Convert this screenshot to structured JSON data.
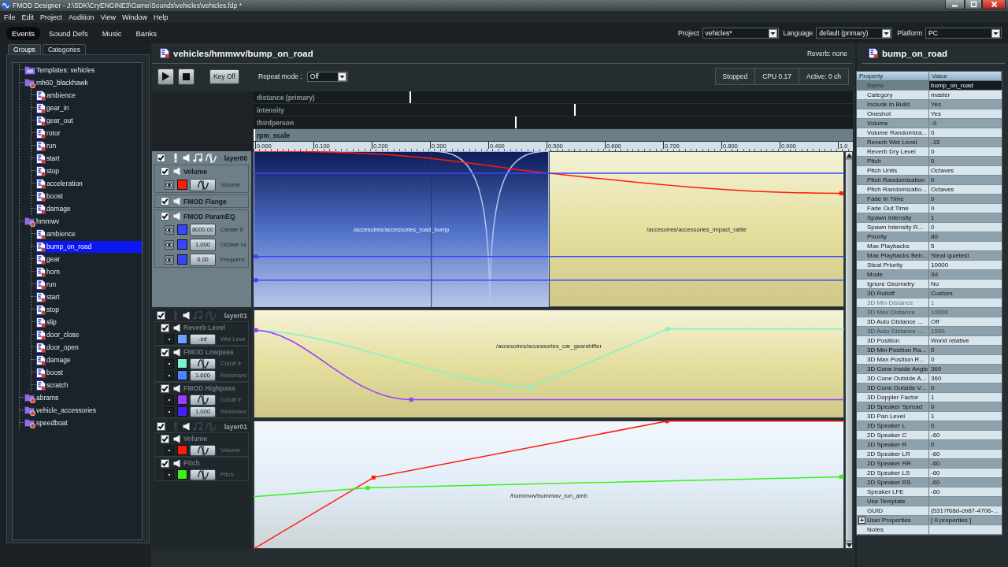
{
  "window": {
    "title": "FMOD Designer - J:\\SDK\\CryENGINE3\\Game\\Sounds\\vehicles\\vehicles.fdp *"
  },
  "menu": [
    "File",
    "Edit",
    "Project",
    "Audition",
    "View",
    "Window",
    "Help"
  ],
  "modes": [
    {
      "label": "Events",
      "selected": true
    },
    {
      "label": "Sound Defs",
      "selected": false
    },
    {
      "label": "Music",
      "selected": false
    },
    {
      "label": "Banks",
      "selected": false
    }
  ],
  "selectors": [
    {
      "label": "Project",
      "value": "vehicles*"
    },
    {
      "label": "Language",
      "value": "default (primary)"
    },
    {
      "label": "Platform",
      "value": "PC"
    }
  ],
  "sidebar": {
    "tabs": [
      {
        "label": "Groups",
        "selected": true
      },
      {
        "label": "Categories",
        "selected": false
      }
    ],
    "tree": [
      {
        "label": "Templates: vehicles",
        "kind": "template",
        "selected": false
      },
      {
        "label": "mh60_blackhawk",
        "kind": "group",
        "selected": false,
        "children": [
          {
            "label": "ambience",
            "kind": "event",
            "selected": false
          },
          {
            "label": "gear_in",
            "kind": "event",
            "selected": false
          },
          {
            "label": "gear_out",
            "kind": "event",
            "selected": false
          },
          {
            "label": "rotor",
            "kind": "event",
            "selected": false
          },
          {
            "label": "run",
            "kind": "event",
            "selected": false
          },
          {
            "label": "start",
            "kind": "event",
            "selected": false
          },
          {
            "label": "stop",
            "kind": "event",
            "selected": false
          },
          {
            "label": "acceleration",
            "kind": "event",
            "selected": false
          },
          {
            "label": "boost",
            "kind": "event",
            "selected": false
          },
          {
            "label": "damage",
            "kind": "event",
            "selected": false
          }
        ]
      },
      {
        "label": "hmmwv",
        "kind": "group",
        "selected": false,
        "children": [
          {
            "label": "ambience",
            "kind": "event",
            "selected": false
          },
          {
            "label": "bump_on_road",
            "kind": "event",
            "selected": true
          },
          {
            "label": "gear",
            "kind": "event",
            "selected": false
          },
          {
            "label": "horn",
            "kind": "event",
            "selected": false
          },
          {
            "label": "run",
            "kind": "event",
            "selected": false
          },
          {
            "label": "start",
            "kind": "event",
            "selected": false
          },
          {
            "label": "stop",
            "kind": "event",
            "selected": false
          },
          {
            "label": "slip",
            "kind": "event",
            "selected": false
          },
          {
            "label": "door_close",
            "kind": "event",
            "selected": false
          },
          {
            "label": "door_open",
            "kind": "event",
            "selected": false
          },
          {
            "label": "damage",
            "kind": "event",
            "selected": false
          },
          {
            "label": "boost",
            "kind": "event",
            "selected": false
          },
          {
            "label": "scratch",
            "kind": "event",
            "selected": false
          }
        ]
      },
      {
        "label": "abrams",
        "kind": "group",
        "selected": false
      },
      {
        "label": "vehicle_accessories",
        "kind": "group",
        "selected": false
      },
      {
        "label": "speedboat",
        "kind": "group",
        "selected": false
      }
    ]
  },
  "event": {
    "title": "vehicles/hmmwv/bump_on_road",
    "reverb": "Reverb: none",
    "key_off": "Key Off",
    "repeat_mode": {
      "label": "Repeat mode :",
      "value": "Off"
    },
    "status": [
      "Stopped",
      "CPU 0.17",
      "Active: 0 ch"
    ],
    "parameters": [
      {
        "name": "distance (primary)",
        "selected": false,
        "level": 0.26
      },
      {
        "name": "intensity",
        "selected": false,
        "level": 0.535
      },
      {
        "name": "thirdperson",
        "selected": false,
        "level": 0.436
      },
      {
        "name": "rpm_scale",
        "selected": true,
        "level": 0
      }
    ],
    "ruler": [
      "0.000",
      "0.100",
      "0.200",
      "0.300",
      "0.400",
      "0.500",
      "0.600",
      "0.700",
      "0.800",
      "0.900",
      "1.0"
    ],
    "layers": [
      {
        "name": "layer00",
        "selected": true,
        "checked": true,
        "effects": [
          {
            "name": "Volume",
            "checked": true,
            "params": [
              {
                "kind": "curve",
                "color": "#ff1a0a",
                "label": "Volume"
              }
            ]
          },
          {
            "name": "FMOD Flange",
            "checked": true
          },
          {
            "name": "FMOD ParamEQ",
            "checked": true,
            "params": [
              {
                "kind": "value",
                "value": "8000.00",
                "color": "#3b45ff",
                "label": "Center fr"
              },
              {
                "kind": "value",
                "value": "1.000",
                "color": "#3b45ff",
                "label": "Octave ra"
              },
              {
                "kind": "value",
                "value": "0.00",
                "color": "#3b45ff",
                "label": "Frequenc"
              }
            ]
          }
        ],
        "instances": [
          {
            "label": "/accesoires/accessories_road_bump",
            "selected": true,
            "color": "#4d6fc6"
          },
          {
            "label": "/accesoires/accessories_impact_rattle",
            "selected": false,
            "color": "#e5df9e"
          }
        ]
      },
      {
        "name": "layer01",
        "selected": false,
        "checked": true,
        "effects": [
          {
            "name": "Reverb Level",
            "checked": true,
            "params": [
              {
                "kind": "value",
                "value": "-inf",
                "color": "#6f9cff",
                "label": "Wet Leve"
              }
            ]
          },
          {
            "name": "FMOD Lowpass",
            "checked": true,
            "params": [
              {
                "kind": "curve",
                "color": "#7cf5c8",
                "label": "Cutoff fr"
              },
              {
                "kind": "value",
                "value": "1.000",
                "color": "#4a86ff",
                "label": "Resonanc"
              }
            ]
          },
          {
            "name": "FMOD Highpass",
            "checked": true,
            "params": [
              {
                "kind": "curve",
                "color": "#9b3cff",
                "label": "Cutoff fr"
              },
              {
                "kind": "value",
                "value": "1.000",
                "color": "#4a1cff",
                "label": "Resonanc"
              }
            ]
          }
        ],
        "instances": [
          {
            "label": "/accesoires/accessories_car_gearshifter",
            "selected": false,
            "color": "#e5df9e"
          }
        ]
      },
      {
        "name": "layer01",
        "selected": false,
        "checked": true,
        "effects": [
          {
            "name": "Volume",
            "checked": true,
            "params": [
              {
                "kind": "curve",
                "color": "#ff1a0a",
                "label": "Volume"
              }
            ]
          },
          {
            "name": "Pitch",
            "checked": true,
            "params": [
              {
                "kind": "curve",
                "color": "#3cf01a",
                "label": "Pitch"
              }
            ]
          }
        ],
        "instances": [
          {
            "label": "/hummvw/hummwv_run_amb",
            "selected": false,
            "color": "#e2edf8"
          }
        ]
      }
    ]
  },
  "properties": {
    "title": "bump_on_road",
    "columns": [
      "Property",
      "Value"
    ],
    "rows": [
      {
        "property": "Name",
        "value": "bump_on_road",
        "selected": true,
        "disabled": false
      },
      {
        "property": "Category",
        "value": "master",
        "selected": false,
        "disabled": false
      },
      {
        "property": "Include in Build",
        "value": "Yes",
        "selected": false,
        "disabled": false
      },
      {
        "property": "Oneshot",
        "value": "Yes",
        "selected": false,
        "disabled": false
      },
      {
        "property": "Volume",
        "value": "-9",
        "selected": false,
        "disabled": false
      },
      {
        "property": "Volume Randomiza...",
        "value": "0",
        "selected": false,
        "disabled": false
      },
      {
        "property": "Reverb Wet Level",
        "value": "-15",
        "selected": false,
        "disabled": false
      },
      {
        "property": "Reverb Dry Level",
        "value": "0",
        "selected": false,
        "disabled": false
      },
      {
        "property": "Pitch",
        "value": "0",
        "selected": false,
        "disabled": false
      },
      {
        "property": "Pitch Units",
        "value": "Octaves",
        "selected": false,
        "disabled": false
      },
      {
        "property": "Pitch Randomization",
        "value": "0",
        "selected": false,
        "disabled": false
      },
      {
        "property": "Pitch Randomizatio...",
        "value": "Octaves",
        "selected": false,
        "disabled": false
      },
      {
        "property": "Fade In Time",
        "value": "0",
        "selected": false,
        "disabled": false
      },
      {
        "property": "Fade Out Time",
        "value": "0",
        "selected": false,
        "disabled": false
      },
      {
        "property": "Spawn Intensity",
        "value": "1",
        "selected": false,
        "disabled": false
      },
      {
        "property": "Spawn Intensity R...",
        "value": "0",
        "selected": false,
        "disabled": false
      },
      {
        "property": "Priority",
        "value": "80",
        "selected": false,
        "disabled": false
      },
      {
        "property": "Max Playbacks",
        "value": "5",
        "selected": false,
        "disabled": false
      },
      {
        "property": "Max Playbacks Beh...",
        "value": "Steal quietest",
        "selected": false,
        "disabled": false
      },
      {
        "property": "Steal Priority",
        "value": "10000",
        "selected": false,
        "disabled": false
      },
      {
        "property": "Mode",
        "value": "3d",
        "selected": false,
        "disabled": false
      },
      {
        "property": "Ignore Geometry",
        "value": "No",
        "selected": false,
        "disabled": false
      },
      {
        "property": "3D Rolloff",
        "value": "Custom",
        "selected": false,
        "disabled": false
      },
      {
        "property": "3D Min Distance",
        "value": "1",
        "selected": false,
        "disabled": true
      },
      {
        "property": "3D Max Distance",
        "value": "10000",
        "selected": false,
        "disabled": true
      },
      {
        "property": "3D Auto Distance ...",
        "value": "Off",
        "selected": false,
        "disabled": false
      },
      {
        "property": "3D Auto Distance ...",
        "value": "1500",
        "selected": false,
        "disabled": true
      },
      {
        "property": "3D Position",
        "value": "World relative",
        "selected": false,
        "disabled": false
      },
      {
        "property": "3D Min Position Ra...",
        "value": "0",
        "selected": false,
        "disabled": false
      },
      {
        "property": "3D Max Position R...",
        "value": "0",
        "selected": false,
        "disabled": false
      },
      {
        "property": "3D Cone Inside Angle",
        "value": "360",
        "selected": false,
        "disabled": false
      },
      {
        "property": "3D Cone Outside A...",
        "value": "360",
        "selected": false,
        "disabled": false
      },
      {
        "property": "3D Cone Outside V...",
        "value": "0",
        "selected": false,
        "disabled": false
      },
      {
        "property": "3D Doppler Factor",
        "value": "1",
        "selected": false,
        "disabled": false
      },
      {
        "property": "3D Speaker Spread",
        "value": "0",
        "selected": false,
        "disabled": false
      },
      {
        "property": "3D Pan Level",
        "value": "1",
        "selected": false,
        "disabled": false
      },
      {
        "property": "2D Speaker L",
        "value": "0",
        "selected": false,
        "disabled": false
      },
      {
        "property": "2D Speaker C",
        "value": "-60",
        "selected": false,
        "disabled": false
      },
      {
        "property": "2D Speaker R",
        "value": "0",
        "selected": false,
        "disabled": false
      },
      {
        "property": "2D Speaker LR",
        "value": "-60",
        "selected": false,
        "disabled": false
      },
      {
        "property": "2D Speaker RR",
        "value": "-60",
        "selected": false,
        "disabled": false
      },
      {
        "property": "2D Speaker LS",
        "value": "-60",
        "selected": false,
        "disabled": false
      },
      {
        "property": "2D Speaker RS",
        "value": "-60",
        "selected": false,
        "disabled": false
      },
      {
        "property": "Speaker LFE",
        "value": "-60",
        "selected": false,
        "disabled": false
      },
      {
        "property": "Use Template",
        "selected": false,
        "disabled": false
      },
      {
        "property": "GUID",
        "value": "{5317f68d-cb87-4706-...",
        "selected": false,
        "disabled": false
      },
      {
        "property": "User Properties",
        "value": "[ 0 properties ]",
        "selected": false,
        "disabled": false,
        "expanded": false
      },
      {
        "property": "Notes",
        "selected": false,
        "disabled": false
      }
    ]
  }
}
